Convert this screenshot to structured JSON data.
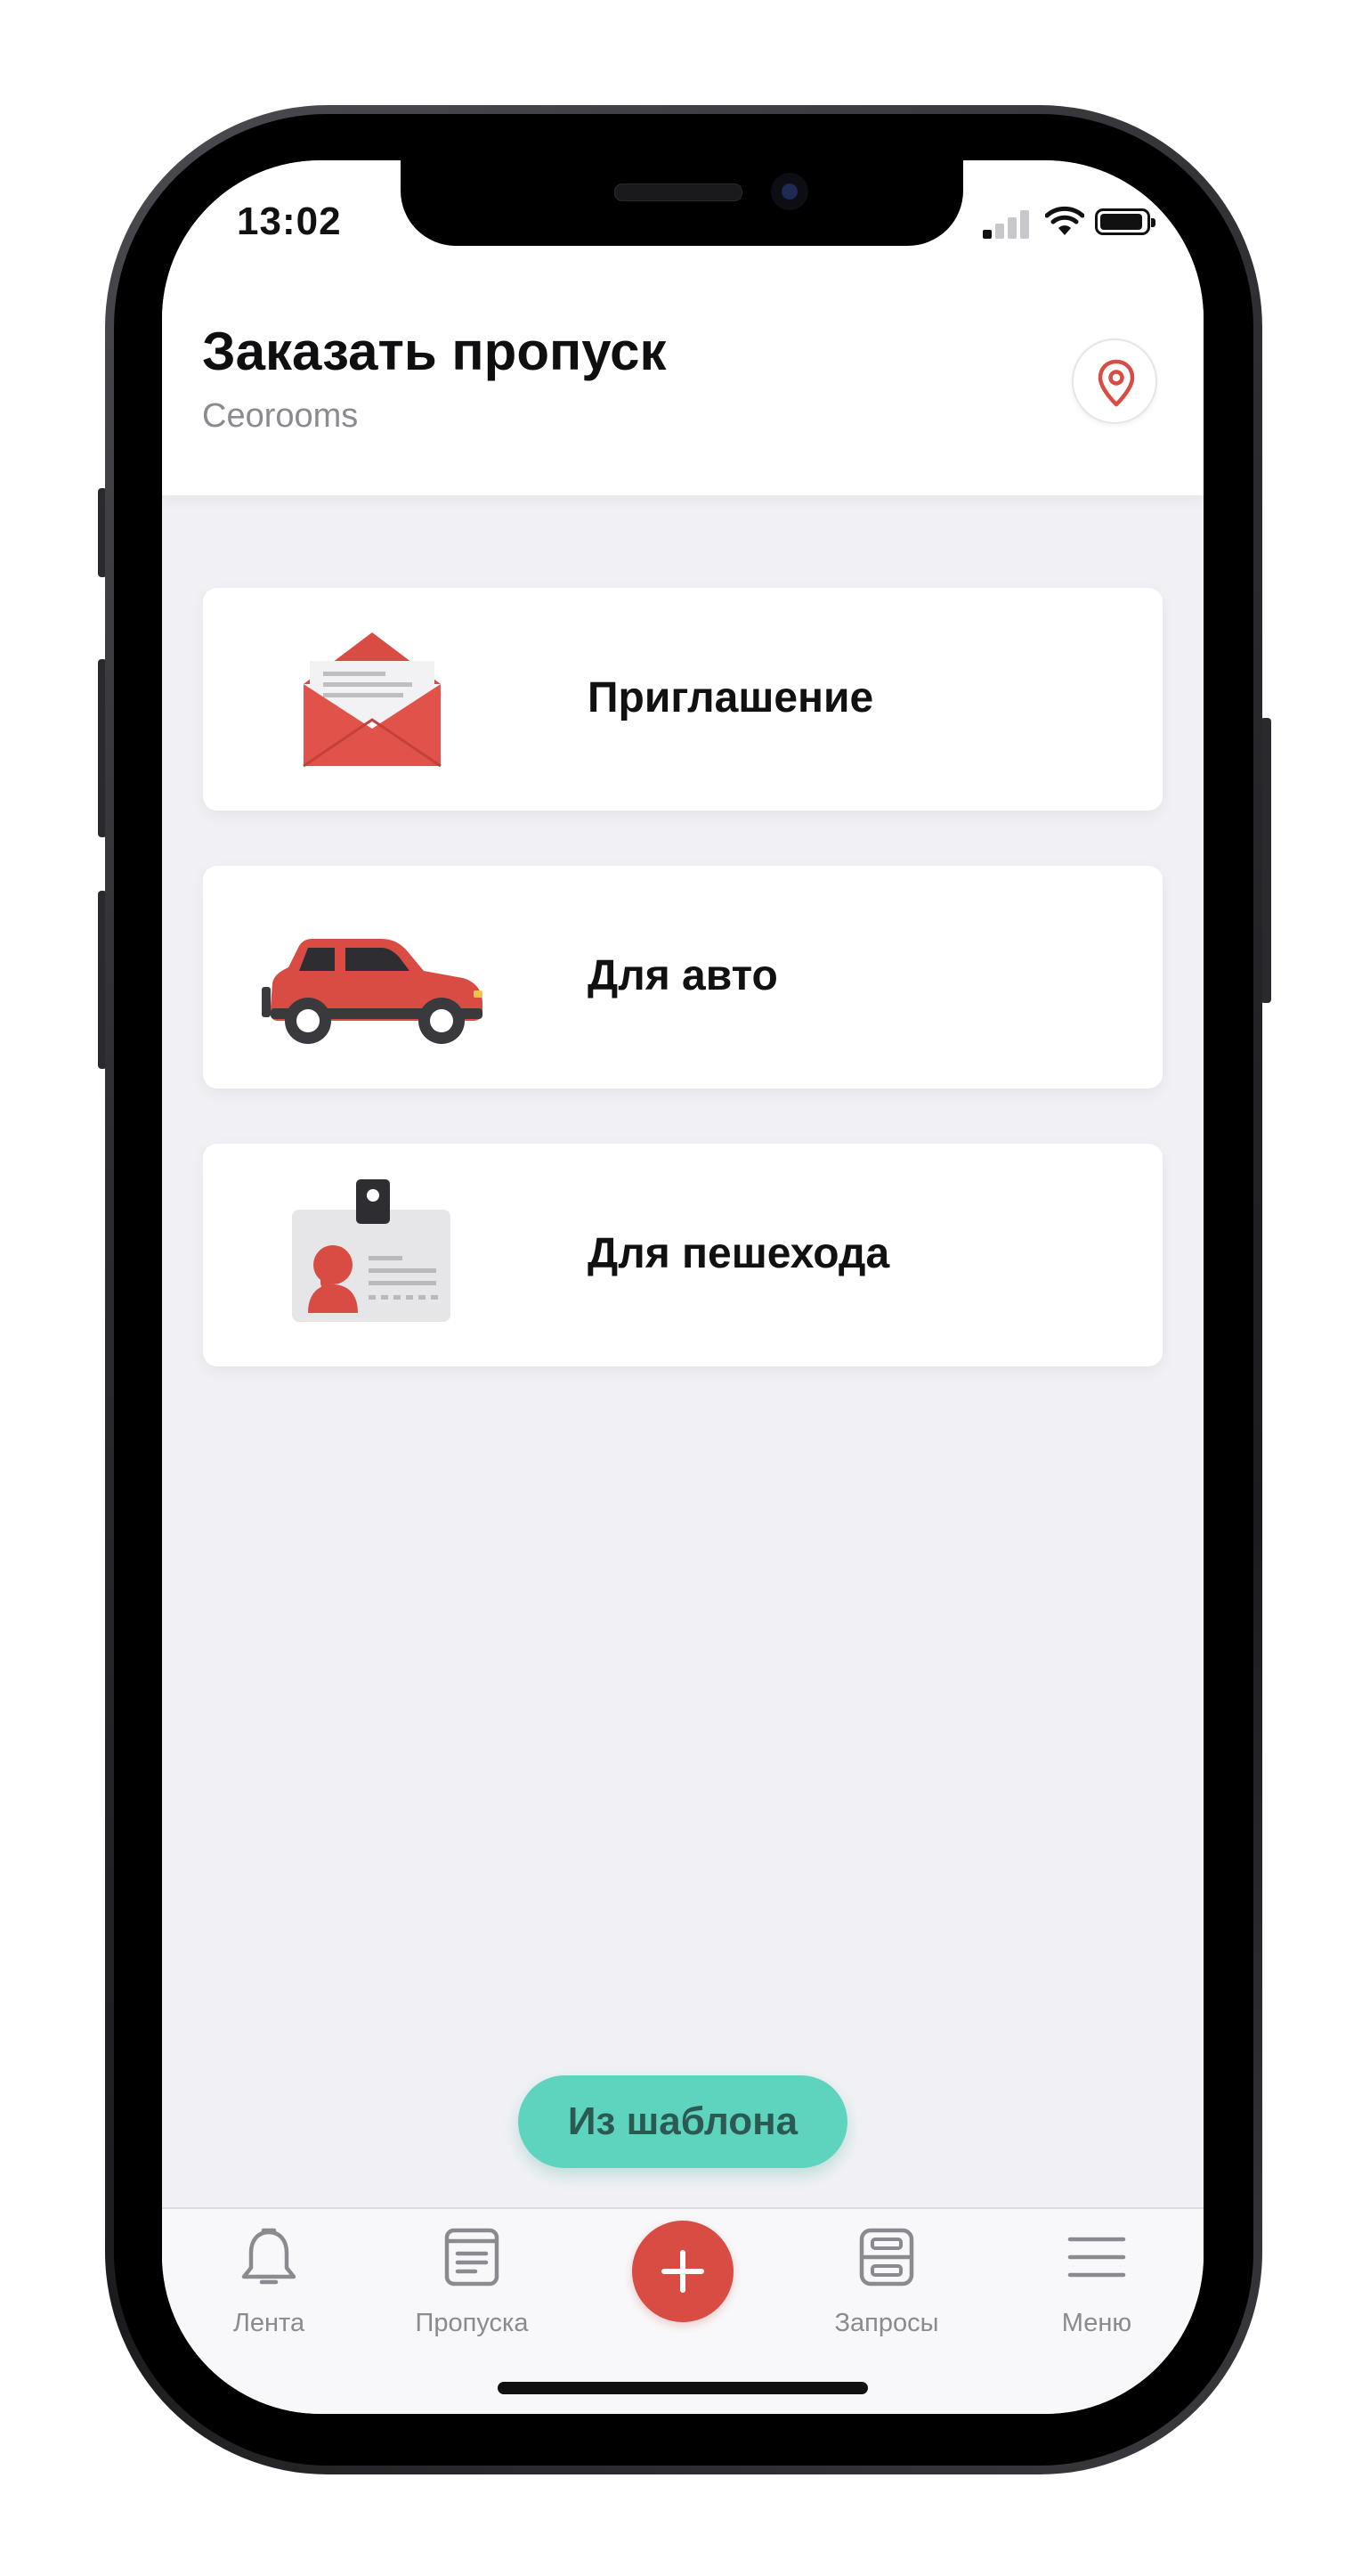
{
  "status_bar": {
    "time": "13:02"
  },
  "header": {
    "title": "Заказать пропуск",
    "subtitle": "Ceorooms"
  },
  "options": [
    {
      "label": "Приглашение",
      "icon": "envelope-icon"
    },
    {
      "label": "Для авто",
      "icon": "car-icon"
    },
    {
      "label": "Для пешехода",
      "icon": "id-badge-icon"
    }
  ],
  "template_button": {
    "label": "Из шаблона"
  },
  "tab_bar": {
    "items": [
      {
        "label": "Лента",
        "icon": "bell-icon"
      },
      {
        "label": "Пропуска",
        "icon": "pass-document-icon"
      },
      {
        "label": "",
        "icon": "plus-icon"
      },
      {
        "label": "Запросы",
        "icon": "requests-icon"
      },
      {
        "label": "Меню",
        "icon": "hamburger-menu-icon"
      }
    ]
  },
  "colors": {
    "accent_red": "#d84c44",
    "teal_button": "#5ed4bf",
    "background": "#f1f1f5",
    "tab_inactive": "#8a8a90"
  }
}
